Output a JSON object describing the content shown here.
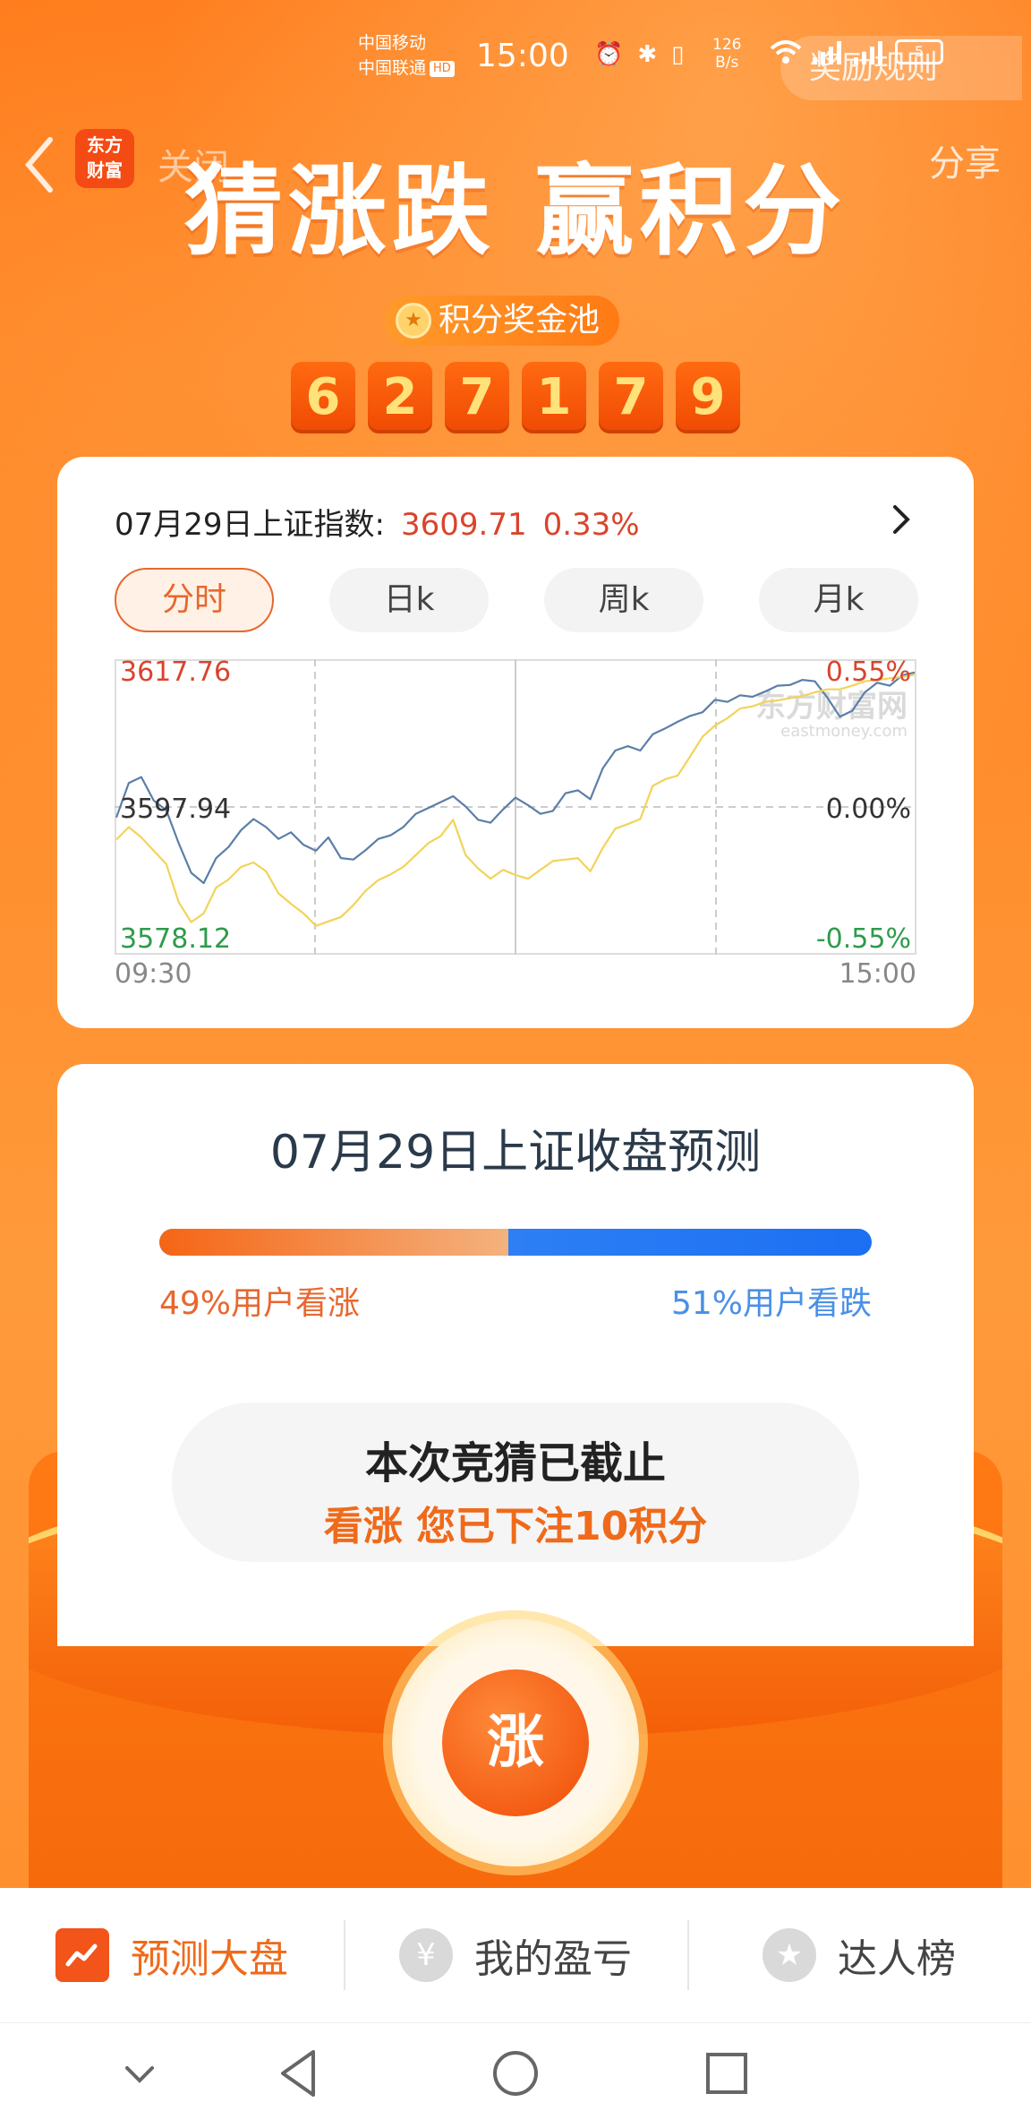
{
  "status_bar": {
    "carrier_1": "中国移动",
    "carrier_2": "中国联通",
    "hd_badge": "HD",
    "time": "15:00",
    "net_speed_value": "126",
    "net_speed_unit": "B/s",
    "battery": "5"
  },
  "header": {
    "rules_button": "奖励规则",
    "app_logo_line1": "东方",
    "app_logo_line2": "财富",
    "close_label": "关闭",
    "share_label": "分享",
    "title": "猜涨跌 赢积分",
    "pool_label": "积分奖金池",
    "pool_digits": [
      "6",
      "2",
      "7",
      "1",
      "7",
      "9"
    ]
  },
  "chart_card": {
    "index_label": "07月29日上证指数:",
    "index_value": "3609.71",
    "index_change": "0.33%",
    "tabs": [
      "分时",
      "日k",
      "周k",
      "月k"
    ],
    "active_tab": "分时",
    "watermark": "东方财富网",
    "watermark_sub": "eastmoney.com",
    "time_start": "09:30",
    "time_end": "15:00",
    "colors": {
      "up": "#d9442c",
      "down": "#2e9b4a",
      "price_line": "#5b7fa8",
      "avg_line": "#f2d35a"
    }
  },
  "chart_data": {
    "type": "line",
    "ylabel_left": [
      "3617.76",
      "3597.94",
      "3578.12"
    ],
    "ylabel_right": [
      "0.55%",
      "0.00%",
      "-0.55%"
    ],
    "ylim": [
      3578.12,
      3617.76
    ],
    "x_start": "09:30",
    "x_end": "15:00",
    "grid": true,
    "series": [
      {
        "values": [
          3596.5,
          3601.2,
          3602.0,
          3598.8,
          3597.5,
          3593.0,
          3589.0,
          3587.6,
          3591.0,
          3592.5,
          3594.8,
          3596.3,
          3595.2,
          3593.6,
          3594.5,
          3592.8,
          3592.0,
          3593.8,
          3591.0,
          3590.8,
          3592.1,
          3593.6,
          3594.1,
          3595.2,
          3597.0,
          3597.8,
          3598.6,
          3599.4,
          3598.0,
          3596.2,
          3595.8,
          3597.6,
          3599.2,
          3598.2,
          3597.0,
          3597.4,
          3599.8,
          3600.2,
          3599.0,
          3603.2,
          3605.6,
          3606.2,
          3605.6,
          3607.8,
          3608.6,
          3609.5,
          3610.3,
          3610.8,
          3612.5,
          3612.2,
          3613.1,
          3612.9,
          3613.6,
          3614.4,
          3614.5,
          3615.2,
          3615.0,
          3612.8,
          3610.2,
          3611.0,
          3613.5,
          3614.8,
          3614.4,
          3615.8,
          3616.2
        ]
      },
      {
        "values": [
          3593.5,
          3595.2,
          3593.8,
          3592.0,
          3590.2,
          3585.0,
          3582.3,
          3583.5,
          3587.0,
          3588.1,
          3589.8,
          3590.4,
          3589.2,
          3586.2,
          3584.8,
          3583.5,
          3581.8,
          3582.4,
          3583.0,
          3584.6,
          3586.6,
          3588.0,
          3588.8,
          3589.8,
          3591.4,
          3593.0,
          3594.0,
          3596.2,
          3591.4,
          3589.6,
          3588.2,
          3589.4,
          3588.7,
          3588.2,
          3589.4,
          3590.6,
          3590.8,
          3591.0,
          3589.2,
          3592.4,
          3595.0,
          3595.6,
          3596.3,
          3600.8,
          3601.7,
          3602.2,
          3604.8,
          3607.5,
          3609.0,
          3610.0,
          3611.3,
          3611.6,
          3612.2,
          3612.4,
          3612.7,
          3613.0,
          3613.5,
          3613.9,
          3613.9,
          3614.4,
          3615.0,
          3615.2,
          3615.4,
          3615.6,
          3615.9
        ]
      }
    ]
  },
  "prediction": {
    "title": "07月29日上证收盘预测",
    "up_percent": 49,
    "up_label": "49%用户看涨",
    "down_label": "51%用户看跌",
    "closed_title": "本次竞猜已截止",
    "bet_text": "看涨 您已下注10积分",
    "rise_button": "涨"
  },
  "tabbar": {
    "items": [
      "预测大盘",
      "我的盈亏",
      "达人榜"
    ],
    "active": "预测大盘"
  }
}
